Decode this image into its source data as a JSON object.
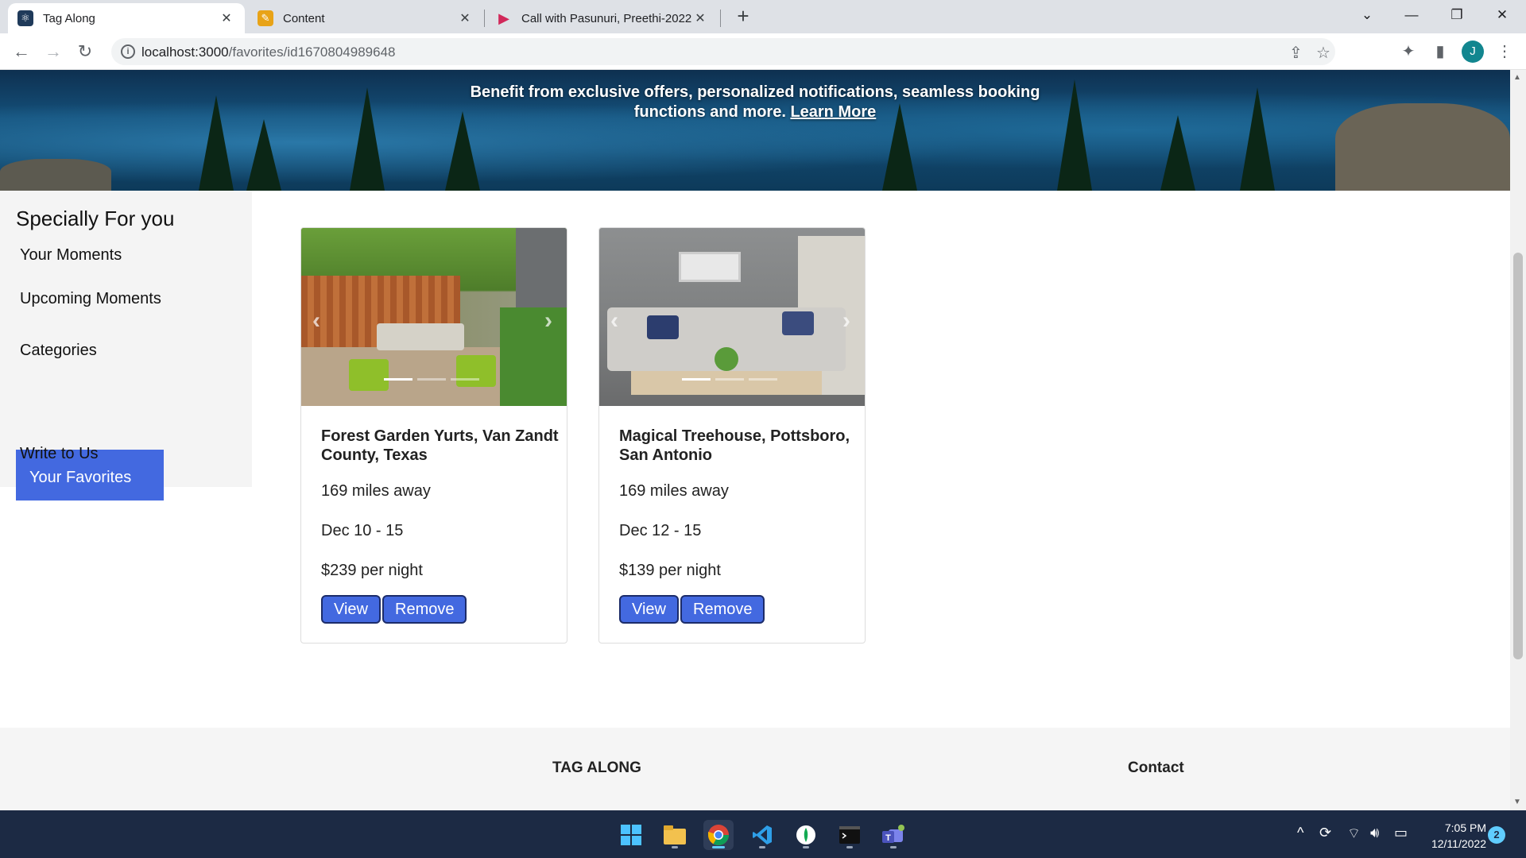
{
  "browser": {
    "tabs": [
      {
        "title": "Tag Along",
        "icon": "react-icon",
        "active": true
      },
      {
        "title": "Content",
        "icon": "pencil-icon",
        "active": false
      },
      {
        "title": "Call with Pasunuri, Preethi-2022",
        "icon": "video-icon",
        "active": false
      }
    ],
    "url_host": "localhost:3000",
    "url_path": "/favorites/id1670804989648",
    "profile_initial": "J"
  },
  "hero": {
    "text": "Benefit from exclusive offers, personalized notifications, seamless booking functions and more.",
    "link": "Learn More"
  },
  "sidebar": {
    "title": "Specially For you",
    "items": [
      {
        "label": "Your Moments",
        "active": false
      },
      {
        "label": "Upcoming Moments",
        "active": false
      },
      {
        "label": "Categories",
        "active": false
      },
      {
        "label": "Your Favorites",
        "active": true
      },
      {
        "label": "Write to Us",
        "active": false
      }
    ]
  },
  "favorites": [
    {
      "name": "Forest Garden Yurts, Van Zandt County, Texas",
      "distance": "169 miles away",
      "dates": "Dec 10 - 15",
      "price": "$239 per night",
      "view_label": "View",
      "remove_label": "Remove"
    },
    {
      "name": "Magical Treehouse, Pottsboro, San Antonio",
      "distance": "169 miles away",
      "dates": "Dec 12 - 15",
      "price": "$139 per night",
      "view_label": "View",
      "remove_label": "Remove"
    }
  ],
  "footer": {
    "brand": "TAG ALONG",
    "contact": "Contact"
  },
  "taskbar": {
    "time": "7:05 PM",
    "date": "12/11/2022",
    "notifications": "2"
  },
  "colors": {
    "accent": "#4369e0",
    "taskbar": "#1c2a44"
  }
}
